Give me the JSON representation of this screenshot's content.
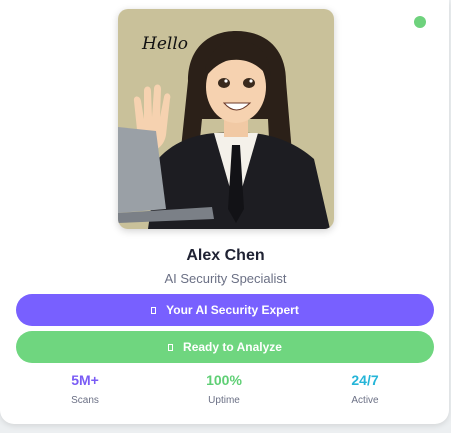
{
  "avatar": {
    "speech_text": "Hello"
  },
  "profile": {
    "name": "Alex Chen",
    "role": "AI Security Specialist"
  },
  "buttons": {
    "primary": {
      "label": "Your AI Security Expert",
      "icon": "square-icon",
      "color": "#7860ff"
    },
    "secondary": {
      "label": "Ready to Analyze",
      "icon": "square-icon",
      "color": "#6fd67f"
    }
  },
  "status": {
    "color": "#6ed27d"
  },
  "stats": [
    {
      "value": "5M+",
      "label": "Scans",
      "color": "#7a5cf5"
    },
    {
      "value": "100%",
      "label": "Uptime",
      "color": "#5fcf75"
    },
    {
      "value": "24/7",
      "label": "Active",
      "color": "#25b5d8"
    }
  ]
}
